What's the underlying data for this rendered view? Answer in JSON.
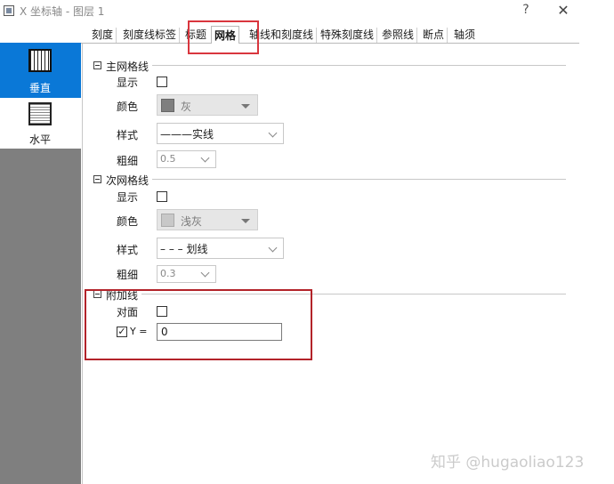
{
  "window": {
    "title": "X 坐标轴 - 图层 1",
    "help_label": "?",
    "close_label": "✕"
  },
  "sidebar": {
    "items": [
      {
        "label": "垂直",
        "icon": "vertical-grid-icon",
        "selected": true
      },
      {
        "label": "水平",
        "icon": "horizontal-grid-icon",
        "selected": false
      }
    ]
  },
  "tabs": [
    {
      "label": "刻度"
    },
    {
      "label": "刻度线标签"
    },
    {
      "label": "标题"
    },
    {
      "label": "网格",
      "active": true
    },
    {
      "label": "轴线和刻度线"
    },
    {
      "label": "特殊刻度线"
    },
    {
      "label": "参照线"
    },
    {
      "label": "断点"
    },
    {
      "label": "轴须"
    }
  ],
  "major_grid": {
    "title": "主网格线",
    "show_label": "显示",
    "show_checked": false,
    "color_label": "颜色",
    "color_value": "灰",
    "color_swatch": "#7f7f7f",
    "style_label": "样式",
    "style_value": "———实线",
    "thickness_label": "粗细",
    "thickness_value": "0.5"
  },
  "minor_grid": {
    "title": "次网格线",
    "show_label": "显示",
    "show_checked": false,
    "color_label": "颜色",
    "color_value": "浅灰",
    "color_swatch": "#c8c8c8",
    "style_label": "样式",
    "style_value": "– – – 划线",
    "thickness_label": "粗细",
    "thickness_value": "0.3"
  },
  "additional_lines": {
    "title": "附加线",
    "opposite_label": "对面",
    "opposite_checked": false,
    "y_label": "Y =",
    "y_checked": true,
    "y_value": "0"
  },
  "watermark": "知乎 @hugaoliao123",
  "colors": {
    "accent": "#0a78d7",
    "highlight": "#d9363e",
    "sidebar_bg": "#7f7f7f"
  }
}
